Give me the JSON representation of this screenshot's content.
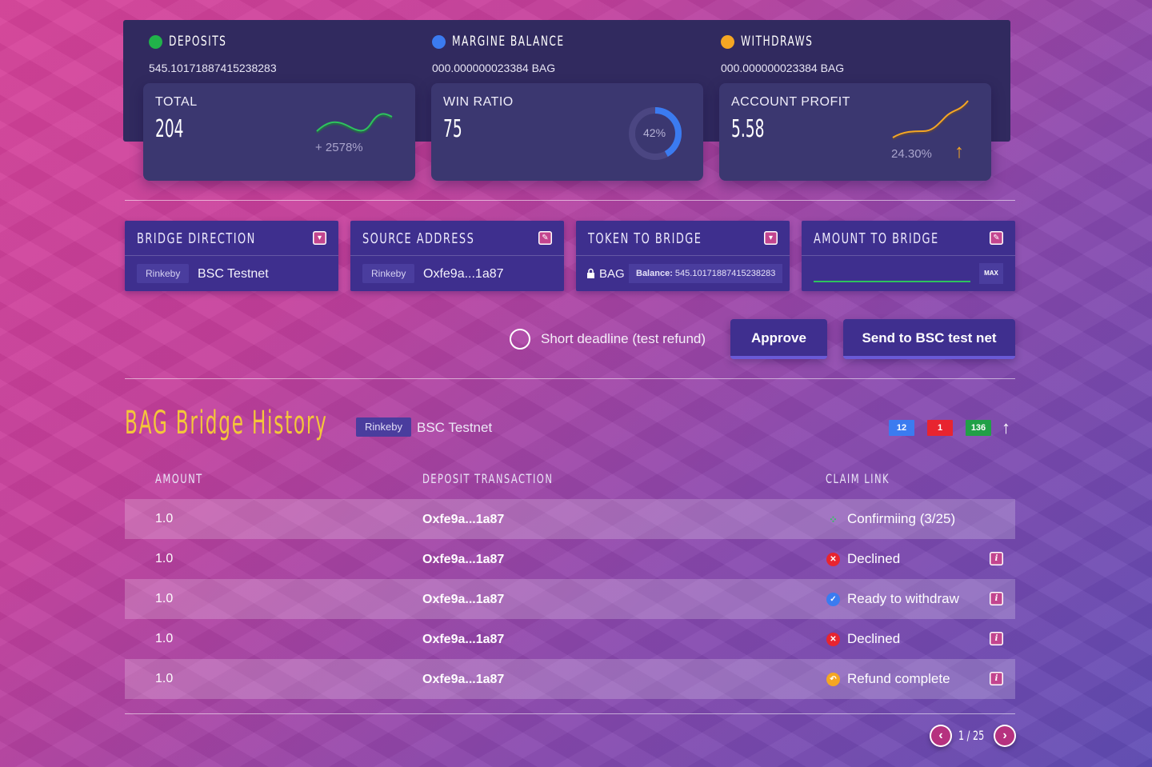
{
  "colors": {
    "deposits_dot": "#21b34a",
    "margin_dot": "#3b7bf0",
    "withdraws_dot": "#f5a623",
    "accent_yellow": "#f4c63a",
    "badge_blue": "#3b7bf0",
    "badge_red": "#e8242f",
    "badge_green": "#21a047"
  },
  "summary": {
    "deposits": {
      "title": "Deposits",
      "value": "545.10171887415238283"
    },
    "margin": {
      "title": "Margine Balance",
      "value": "000.000000023384 BAG"
    },
    "withdraws": {
      "title": "Withdraws",
      "value": "000.000000023384 BAG"
    }
  },
  "cards": {
    "total": {
      "label": "TOTAL",
      "value": "204",
      "sub": "+ 2578%"
    },
    "win_ratio": {
      "label": "WIN RATIO",
      "value": "75",
      "percent": 42,
      "percent_label": "42%"
    },
    "profit": {
      "label": "ACCOUNT PROFIT",
      "value": "5.58",
      "sub": "24.30%"
    }
  },
  "bridge": {
    "direction": {
      "title": "Bridge Direction",
      "from": "Rinkeby",
      "to": "BSC Testnet",
      "icon": "chevron-down-icon"
    },
    "source": {
      "title": "Source Address",
      "network": "Rinkeby",
      "address": "Oxfe9a...1a87",
      "icon": "edit-icon"
    },
    "token": {
      "title": "Token to Bridge",
      "token": "BAG",
      "balance_label": "Balance:",
      "balance_value": "545.10171887415238283",
      "icon": "chevron-down-icon"
    },
    "amount": {
      "title": "Amount to Bridge",
      "value": "",
      "max_label": "MAX",
      "icon": "edit-icon"
    }
  },
  "actions": {
    "deadline_label": "Short deadline (test refund)",
    "approve_label": "Approve",
    "send_label": "Send to BSC test net"
  },
  "history": {
    "title": "BAG Bridge History",
    "from": "Rinkeby",
    "to": "BSC Testnet",
    "badges": [
      "12",
      "1",
      "136"
    ],
    "columns": [
      "Amount",
      "Deposit Transaction",
      "Claim link"
    ],
    "rows": [
      {
        "amount": "1.0",
        "tx": "Oxfe9a...1a87",
        "status": "Confirmiing (3/25)",
        "icon": "loading-icon"
      },
      {
        "amount": "1.0",
        "tx": "Oxfe9a...1a87",
        "status": "Declined",
        "icon": "declined-icon"
      },
      {
        "amount": "1.0",
        "tx": "Oxfe9a...1a87",
        "status": "Ready to withdraw",
        "icon": "check-icon"
      },
      {
        "amount": "1.0",
        "tx": "Oxfe9a...1a87",
        "status": "Declined",
        "icon": "declined-icon"
      },
      {
        "amount": "1.0",
        "tx": "Oxfe9a...1a87",
        "status": "Refund complete",
        "icon": "refund-icon"
      }
    ],
    "pagination": "1 / 25"
  }
}
